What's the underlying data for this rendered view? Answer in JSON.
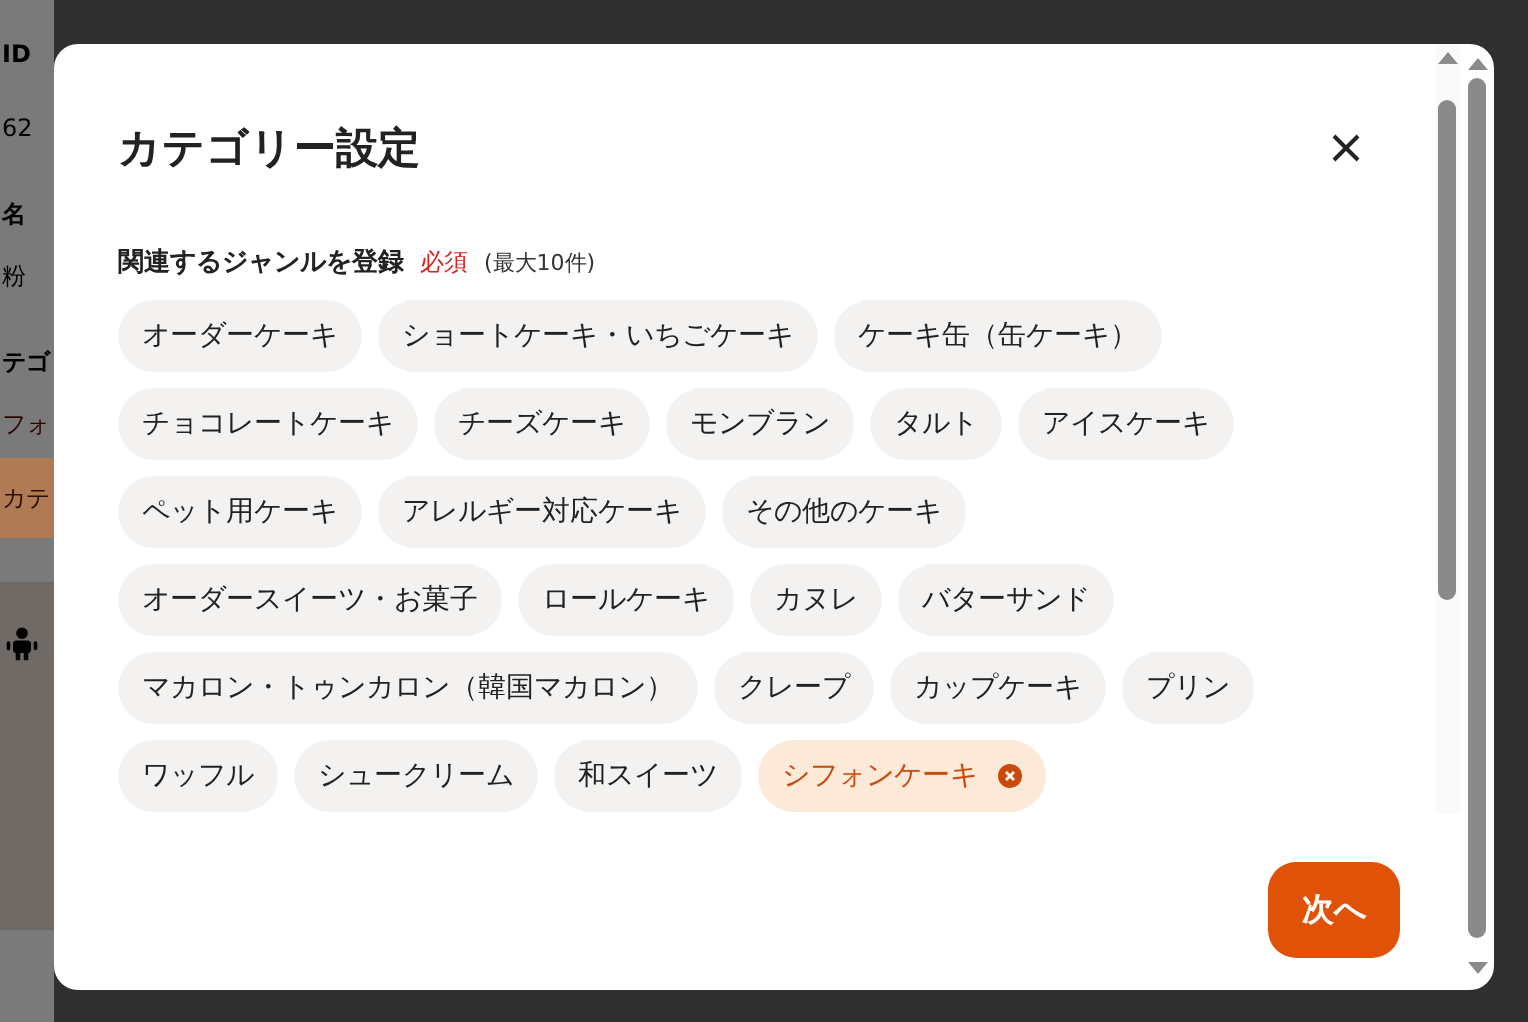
{
  "background_page": {
    "items": [
      {
        "kind": "heading",
        "text": "ID"
      },
      {
        "kind": "value",
        "text": "62"
      },
      {
        "kind": "heading",
        "text": "名"
      },
      {
        "kind": "value",
        "text": "粉"
      },
      {
        "kind": "heading",
        "text": "テゴ"
      },
      {
        "kind": "link",
        "text": "フォ"
      },
      {
        "kind": "band",
        "text": "カテ"
      },
      {
        "kind": "avatar"
      }
    ]
  },
  "dialog": {
    "title": "カテゴリー設定",
    "section_label": "関連するジャンルを登録",
    "required_badge": "必須",
    "limit_note": "(最大10件)",
    "genre_rows": [
      [
        {
          "label": "オーダーケーキ",
          "selected": false
        },
        {
          "label": "ショートケーキ・いちごケーキ",
          "selected": false
        },
        {
          "label": "ケーキ缶（缶ケーキ）",
          "selected": false
        }
      ],
      [
        {
          "label": "チョコレートケーキ",
          "selected": false
        },
        {
          "label": "チーズケーキ",
          "selected": false
        },
        {
          "label": "モンブラン",
          "selected": false
        },
        {
          "label": "タルト",
          "selected": false
        },
        {
          "label": "アイスケーキ",
          "selected": false
        }
      ],
      [
        {
          "label": "ペット用ケーキ",
          "selected": false
        },
        {
          "label": "アレルギー対応ケーキ",
          "selected": false
        },
        {
          "label": "その他のケーキ",
          "selected": false
        }
      ],
      [
        {
          "label": "オーダースイーツ・お菓子",
          "selected": false
        },
        {
          "label": "ロールケーキ",
          "selected": false
        },
        {
          "label": "カヌレ",
          "selected": false
        },
        {
          "label": "バターサンド",
          "selected": false
        }
      ],
      [
        {
          "label": "マカロン・トゥンカロン（韓国マカロン）",
          "selected": false
        },
        {
          "label": "クレープ",
          "selected": false
        },
        {
          "label": "カップケーキ",
          "selected": false
        },
        {
          "label": "プリン",
          "selected": false
        }
      ],
      [
        {
          "label": "ワッフル",
          "selected": false
        },
        {
          "label": "シュークリーム",
          "selected": false
        },
        {
          "label": "和スイーツ",
          "selected": false
        },
        {
          "label": "シフォンケーキ",
          "selected": true
        }
      ]
    ],
    "next_button": "次へ"
  }
}
